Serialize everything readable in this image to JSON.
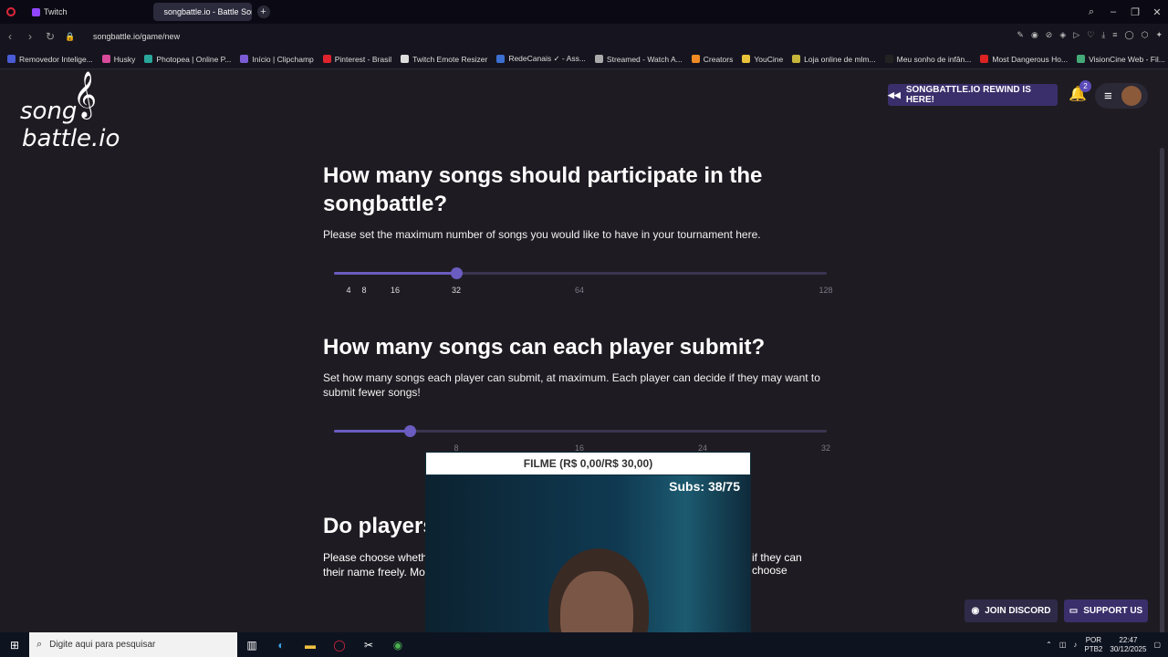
{
  "browser": {
    "tabs": [
      {
        "label": "Twitch",
        "active": false
      },
      {
        "label": "songbattle.io - Battle Son",
        "active": true
      }
    ],
    "url": "songbattle.io/game/new",
    "bookmarks": [
      "Removedor Intelige...",
      "Husky",
      "Photopea | Online P...",
      "Início | Clipchamp",
      "Pinterest - Brasil",
      "Twitch Emote Resizer",
      "RedeCanais ✓ - Ass...",
      "Streamed - Watch A...",
      "Creators",
      "YouCine",
      "Loja online de mlm...",
      "Meu sonho de infân...",
      "Most Dangerous Ho...",
      "VisionCine Web - Fil..."
    ]
  },
  "header": {
    "logo_line1": "song",
    "logo_line2": "battle.io",
    "rewind_label": "SONGBATTLE.IO REWIND IS HERE!",
    "notification_count": "2"
  },
  "sections": {
    "songs_count": {
      "title": "How many songs should participate in the songbattle?",
      "description": "Please set the maximum number of songs you would like to have in your tournament here.",
      "value_fraction": 0.25,
      "ticks": [
        "4",
        "8",
        "16",
        "32",
        "64",
        "128"
      ]
    },
    "songs_per_player": {
      "title": "How many songs can each player submit?",
      "description": "Set how many songs each player can submit, at maximum. Each player can decide if they may want to submit fewer songs!",
      "value_fraction": 0.156,
      "ticks": [
        "8",
        "16",
        "24",
        "32"
      ]
    },
    "players_name": {
      "title": "Do players",
      "description_left": "Please choose whethe",
      "description_right": "if they can choose",
      "description_line2": "their name freely. Mor"
    }
  },
  "overlay": {
    "bar_text": "FILME (R$ 0,00/R$ 30,00)",
    "subs_text": "Subs: 38/75"
  },
  "footer": {
    "discord_label": "JOIN DISCORD",
    "support_label": "SUPPORT US"
  },
  "taskbar": {
    "search_placeholder": "Digite aqui para pesquisar",
    "lang_top": "POR",
    "lang_bottom": "PTB2",
    "time": "22:47",
    "date": "30/12/2025"
  }
}
